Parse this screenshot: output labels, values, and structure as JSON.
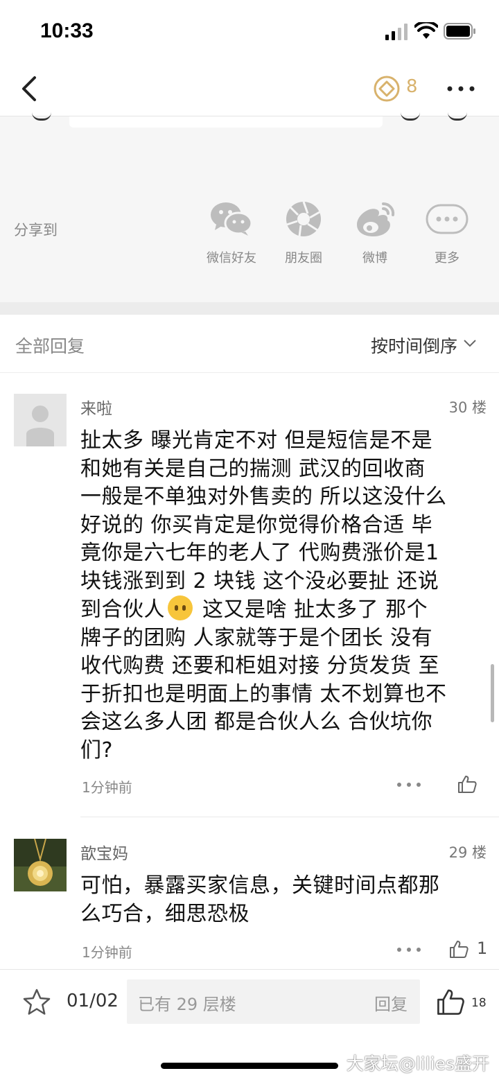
{
  "status_bar": {
    "time": "10:33"
  },
  "nav": {
    "coin_count": "8"
  },
  "share": {
    "label": "分享到",
    "items": [
      {
        "label": "微信好友",
        "icon": "wechat-icon"
      },
      {
        "label": "朋友圈",
        "icon": "moments-icon"
      },
      {
        "label": "微博",
        "icon": "weibo-icon"
      },
      {
        "label": "更多",
        "icon": "more-icon"
      }
    ]
  },
  "replies_header": {
    "title": "全部回复",
    "sort_label": "按时间倒序"
  },
  "comments": [
    {
      "author": "来啦",
      "floor": "30 楼",
      "lines": [
        "扯太多  曝光肯定不对 但是短信是不是",
        "和她有关是自己的揣测  武汉的回收商",
        "一般是不单独对外售卖的 所以这没什么",
        "好说的 你买肯定是你觉得价格合适 毕",
        "竟你是六七年的老人了 代购费涨价是1",
        "块钱涨到到 2 块钱  这个没必要扯   还说",
        "到合伙人",
        " 这又是啥  扯太多了  那个",
        "牌子的团购 人家就等于是个团长 没有",
        "收代购费 还要和柜姐对接  分货发货 至",
        "于折扣也是明面上的事情 太不划算也不",
        "会这么多人团 都是合伙人么 合伙坑你",
        "们?"
      ],
      "time": "1分钟前",
      "likes": ""
    },
    {
      "author": "歆宝妈",
      "floor": "29 楼",
      "lines": [
        "可怕，暴露买家信息，关键时间点都那",
        "么巧合，细思恐极"
      ],
      "time": "1分钟前",
      "likes": "1"
    }
  ],
  "bottom_bar": {
    "page": "01/02",
    "input_placeholder": "已有 29 层楼",
    "reply_label": "回复",
    "like_count": "18",
    "watermark": "大家坛@lilies盛开"
  },
  "colors": {
    "accent_gold": "#d8b26c",
    "share_bg": "#f6f6f6"
  }
}
